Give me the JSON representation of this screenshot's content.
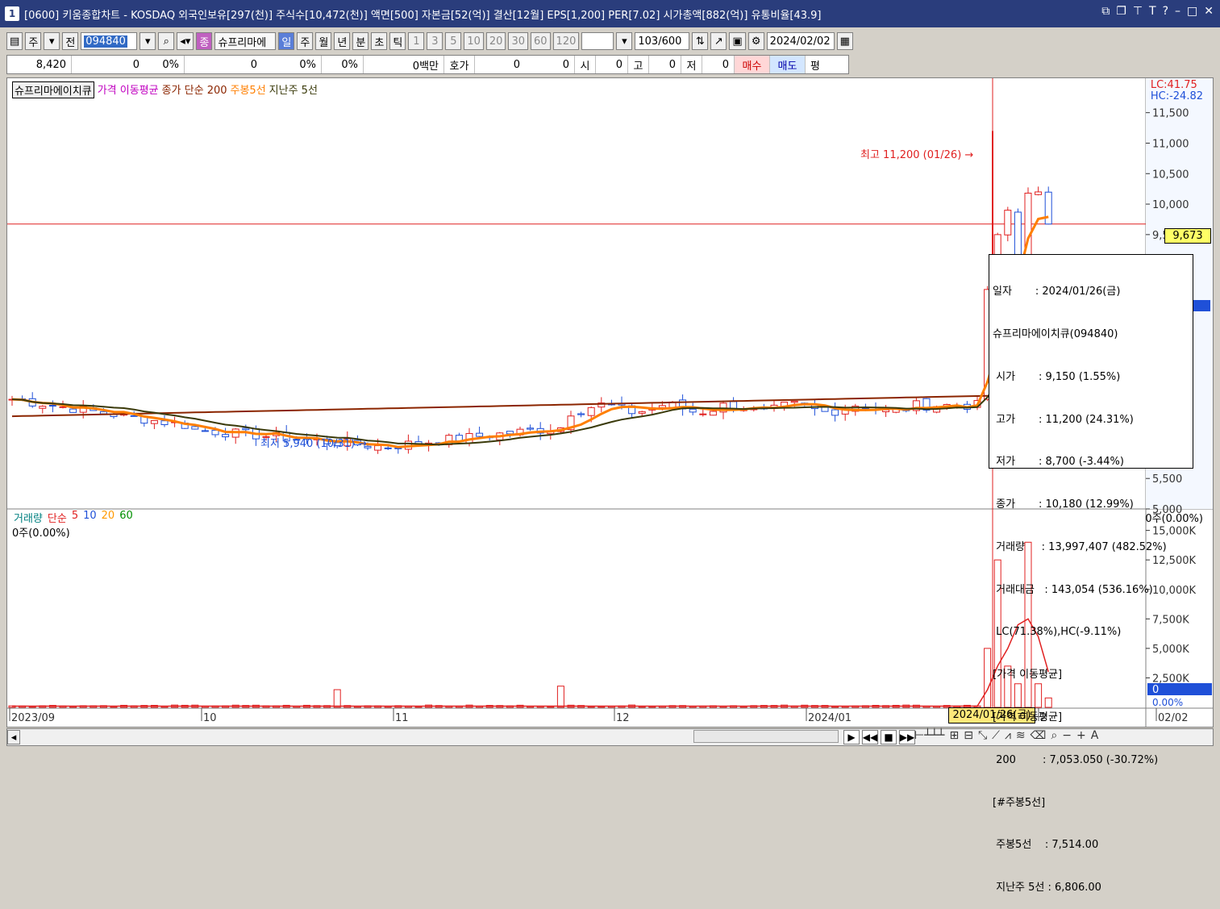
{
  "title": {
    "window_num": "1",
    "text": "[0600] 키움종합차트 - KOSDAQ 외국인보유[297(천)] 주식수[10,472(천)] 액면[500] 자본금[52(억)] 결산[12월] EPS[1,200] PER[7.02] 시가총액[882(억)] 유통비율[43.9]"
  },
  "toolbar": {
    "market": "주",
    "prev": "전",
    "code": "094840",
    "name_badge": "종",
    "name": "슈프리마에",
    "periods": [
      "일",
      "주",
      "월",
      "년",
      "분",
      "초",
      "틱"
    ],
    "intervals": [
      "1",
      "3",
      "5",
      "10",
      "20",
      "30",
      "60",
      "120"
    ],
    "count": "103",
    "count_total": "/600",
    "date": "2024/02/02"
  },
  "quote": {
    "price": "8,420",
    "change": "0",
    "change_pct": "0%",
    "volume": "0",
    "volume_pct": "0%",
    "vol_pct2": "0%",
    "amount": "0백만",
    "hoga_label": "호가",
    "hoga1": "0",
    "hoga2": "0",
    "open_label": "시",
    "open": "0",
    "high_label": "고",
    "high": "0",
    "low_label": "저",
    "low": "0",
    "buy": "매수",
    "sell": "매도",
    "avg": "평"
  },
  "legend": {
    "stock": "슈프리마에이치큐",
    "ma_label": "가격 이동평균",
    "ma200": "종가 단순 200",
    "weekly5": "주봉5선",
    "lastweek5": "지난주 5선"
  },
  "lc": "LC:41.75",
  "hc": "HC:-24.82",
  "price_axis": [
    "11,500",
    "11,000",
    "10,500",
    "10,000",
    "9,500",
    "5,500",
    "5,000"
  ],
  "current_price_tag": "9,673",
  "annotations": {
    "high": "최고 11,200 (01/26) →",
    "low": "최저 5,940 (10/31) →"
  },
  "tooltip": {
    "lines": [
      "일자       : 2024/01/26(금)",
      "슈프리마에이치큐(094840)",
      " 시가       : 9,150 (1.55%)",
      " 고가       : 11,200 (24.31%)",
      " 저가       : 8,700 (-3.44%)",
      " 종가       : 10,180 (12.99%)",
      " 거래량     : 13,997,407 (482.52%)",
      " 거래대금   : 143,054 (536.16%)",
      " LC(71.38%),HC(-9.11%)",
      "[가격 이동평균]",
      "[가격 이동평균]",
      " 200        : 7,053.050 (-30.72%)",
      "[#주봉5선]",
      " 주봉5선    : 7,514.00",
      " 지난주 5선 : 6,806.00"
    ]
  },
  "volume": {
    "legend_label": "거래량",
    "ma_label": "단순",
    "ma_periods": [
      "5",
      "10",
      "20",
      "60"
    ],
    "sub": "0주(0.00%)",
    "right": "0주(0.00%)",
    "axis": [
      "15,000K",
      "12,500K",
      "10,000K",
      "7,500K",
      "5,000K",
      "2,500K",
      "0",
      "0.00%"
    ]
  },
  "x_axis": {
    "labels": [
      "2023/09",
      "10",
      "11",
      "12",
      "2024/01",
      "2",
      "02/02"
    ],
    "cursor_date": "2024/01/26(금)"
  },
  "colors": {
    "up": "#e02020",
    "down": "#1f50d8",
    "ma200": "#8b2500",
    "weekly5": "#ff7f00",
    "lastweek5": "#3a3a0a"
  },
  "chart_data": {
    "type": "candlestick",
    "price_range": [
      5000,
      11800
    ],
    "points": [
      {
        "date": "2023/09",
        "close": 6830
      },
      {
        "date": "2023/10",
        "close": 6300
      },
      {
        "date": "2023/10/31",
        "low": 5940,
        "close": 6000
      },
      {
        "date": "2023/11",
        "close": 6500
      },
      {
        "date": "2023/12",
        "close": 6700
      },
      {
        "date": "2024/01",
        "close": 6900
      },
      {
        "date": "2024/01/26",
        "open": 9150,
        "high": 11200,
        "low": 8700,
        "close": 10180,
        "volume": 13997407
      },
      {
        "date": "2024/02/02",
        "close": 9673
      }
    ]
  }
}
